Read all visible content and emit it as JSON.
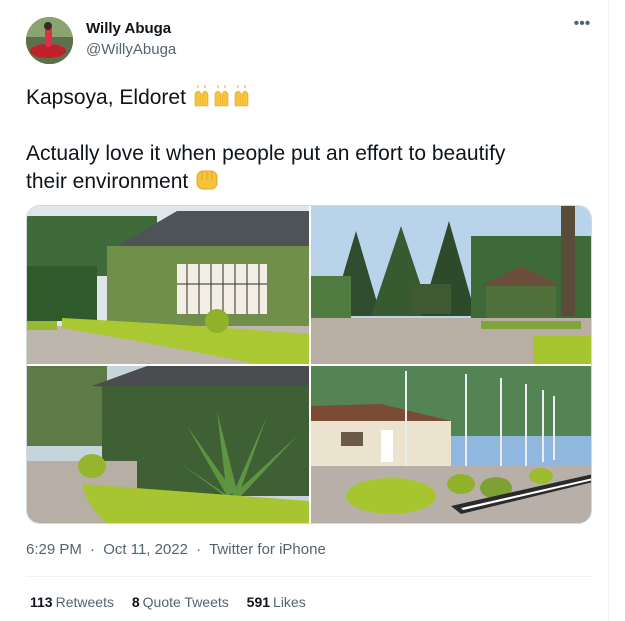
{
  "tweet": {
    "author": {
      "display_name": "Willy Abuga",
      "handle": "@WillyAbuga"
    },
    "text_line1": "Kapsoya, Eldoret",
    "text_line2": "Actually love it when people put an effort to beautify",
    "text_line3": "their environment",
    "emojis": [
      "raising-hands-emoji",
      "raising-hands-emoji",
      "raising-hands-emoji",
      "fist-emoji"
    ],
    "time": "6:29 PM",
    "separator": "·",
    "date": "Oct 11, 2022",
    "source": "Twitter for iPhone",
    "stats": {
      "retweets_count": "113",
      "retweets_label": "Retweets",
      "quotes_count": "8",
      "quotes_label": "Quote Tweets",
      "likes_count": "591",
      "likes_label": "Likes"
    }
  },
  "colors": {
    "text": "#0f1419",
    "secondary": "#536471",
    "border": "#eff3f4"
  }
}
